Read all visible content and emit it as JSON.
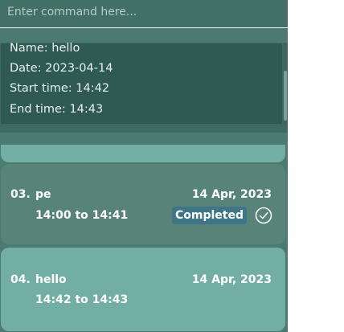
{
  "command": {
    "placeholder": "Enter command here...",
    "value": ""
  },
  "result": {
    "lines": [
      "Name: hello",
      "Date: 2023-04-14",
      "Start time: 14:42",
      "End time: 14:43"
    ]
  },
  "tasks": [
    {
      "index": "03.",
      "name": "pe",
      "date": "14 Apr, 2023",
      "time": "14:00 to 14:41",
      "status": "Completed",
      "icon": "check-circle-icon"
    },
    {
      "index": "04.",
      "name": "hello",
      "date": "14 Apr, 2023",
      "time": "14:42 to 14:43",
      "status": "",
      "icon": ""
    }
  ],
  "colors": {
    "app_background": "#4a7a70",
    "command_box": "#426f66",
    "result_panel": "#2f5a53",
    "card_default": "#578378",
    "card_highlight": "#73aea5",
    "badge": "#3e7688"
  }
}
